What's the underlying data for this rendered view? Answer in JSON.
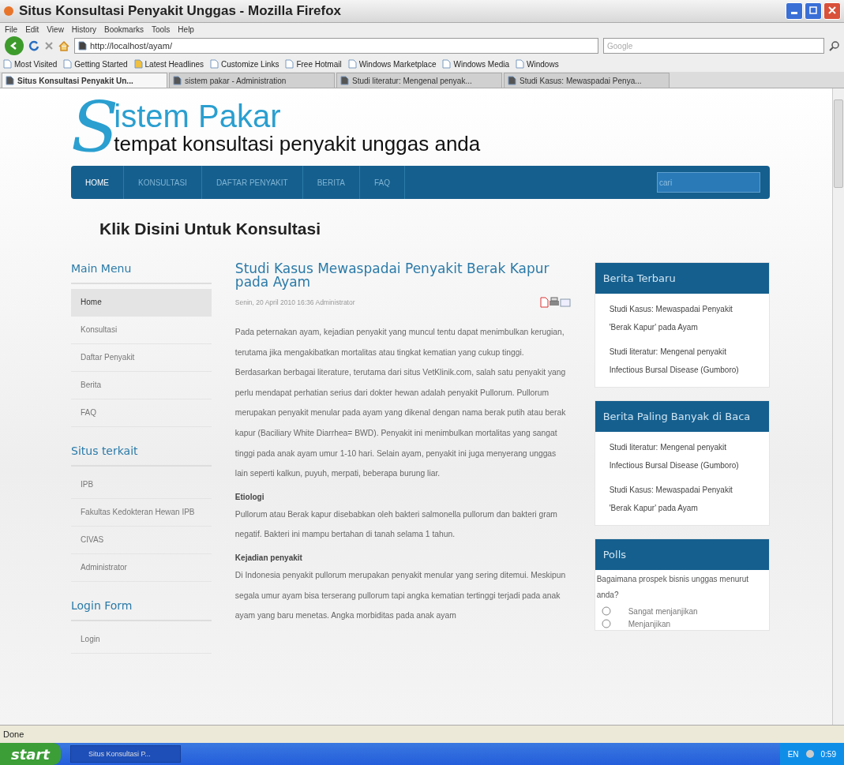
{
  "window": {
    "title": "Situs Konsultasi Penyakit Unggas - Mozilla Firefox"
  },
  "menu": [
    "File",
    "Edit",
    "View",
    "History",
    "Bookmarks",
    "Tools",
    "Help"
  ],
  "address": {
    "value": "http://localhost/ayam/"
  },
  "search": {
    "placeholder": "Google"
  },
  "bookmarks": [
    "Most Visited",
    "Getting Started",
    "Latest Headlines",
    "Customize Links",
    "Free Hotmail",
    "Windows Marketplace",
    "Windows Media",
    "Windows"
  ],
  "tabs": [
    {
      "label": "Situs Konsultasi Penyakit Un...",
      "selected": true
    },
    {
      "label": "sistem pakar - Administration",
      "selected": false
    },
    {
      "label": "Studi literatur: Mengenal penyak...",
      "selected": false
    },
    {
      "label": "Studi Kasus: Mewaspadai Penya...",
      "selected": false
    }
  ],
  "logo": {
    "initial": "S",
    "title": "istem Pakar",
    "tagline": "tempat konsultasi penyakit unggas anda"
  },
  "nav": [
    {
      "label": "HOME",
      "selected": true
    },
    {
      "label": "KONSULTASI",
      "selected": false
    },
    {
      "label": "DAFTAR PENYAKIT",
      "selected": false
    },
    {
      "label": "BERITA",
      "selected": false
    },
    {
      "label": "FAQ",
      "selected": false
    }
  ],
  "nav_search": {
    "placeholder": "cari"
  },
  "banner": "Klik Disini Untuk Konsultasi",
  "sidebar": [
    {
      "title": "Main Menu",
      "items": [
        {
          "label": "Home",
          "selected": true
        },
        {
          "label": "Konsultasi",
          "selected": false
        },
        {
          "label": "Daftar Penyakit",
          "selected": false
        },
        {
          "label": "Berita",
          "selected": false
        },
        {
          "label": "FAQ",
          "selected": false
        }
      ]
    },
    {
      "title": "Situs terkait",
      "items": [
        {
          "label": "IPB",
          "selected": false
        },
        {
          "label": "Fakultas Kedokteran Hewan IPB",
          "selected": false
        },
        {
          "label": "CIVAS",
          "selected": false
        },
        {
          "label": "Administrator",
          "selected": false
        }
      ]
    },
    {
      "title": "Login Form",
      "items": [
        {
          "label": "Login",
          "selected": false
        }
      ]
    }
  ],
  "article": {
    "title": "Studi Kasus Mewaspadai Penyakit Berak Kapur pada Ayam",
    "date": "Senin, 20 April 2010 16:36",
    "author": "Administrator",
    "blocks": [
      {
        "kind": "text",
        "text": "Pada peternakan ayam, kejadian penyakit yang muncul tentu dapat menimbulkan kerugian, terutama jika mengakibatkan mortalitas atau tingkat kematian yang cukup tinggi. Berdasarkan berbagai literature, terutama dari situs VetKlinik.com, salah satu penyakit yang perlu mendapat perhatian serius dari dokter hewan adalah penyakit Pullorum. Pullorum merupakan penyakit menular pada ayam yang dikenal dengan nama berak putih atau berak kapur (Baciliary White Diarrhea= BWD). Penyakit ini menimbulkan mortalitas yang sangat tinggi pada anak ayam umur 1-10 hari. Selain ayam, penyakit ini juga menyerang unggas lain seperti kalkun, puyuh, merpati, beberapa burung liar."
      },
      {
        "kind": "heading",
        "text": "Etiologi"
      },
      {
        "kind": "text",
        "text": "Pullorum atau Berak kapur disebabkan oleh bakteri salmonella pullorum dan bakteri gram negatif. Bakteri ini mampu bertahan di tanah selama 1 tahun."
      },
      {
        "kind": "heading",
        "text": "Kejadian penyakit"
      },
      {
        "kind": "text",
        "text": "Di Indonesia penyakit pullorum merupakan penyakit menular yang sering ditemui. Meskipun segala umur ayam bisa terserang pullorum tapi angka kematian tertinggi terjadi pada anak ayam yang baru menetas. Angka morbiditas pada anak ayam"
      }
    ]
  },
  "modules": [
    {
      "title": "Berita Terbaru",
      "links": [
        "Studi Kasus: Mewaspadai Penyakit 'Berak Kapur' pada Ayam",
        "Studi literatur: Mengenal penyakit Infectious Bursal Disease (Gumboro)"
      ]
    },
    {
      "title": "Berita Paling Banyak di Baca",
      "links": [
        "Studi literatur: Mengenal penyakit Infectious Bursal Disease (Gumboro)",
        "Studi Kasus: Mewaspadai Penyakit 'Berak Kapur' pada Ayam"
      ]
    }
  ],
  "poll": {
    "title": "Polls",
    "question": "Bagaimana prospek bisnis unggas menurut anda?",
    "options": [
      {
        "label": "Sangat menjanjikan",
        "selected": false
      },
      {
        "label": "Menjanjikan",
        "selected": false
      }
    ]
  },
  "status_bar": "Done",
  "taskbar": {
    "start": "start",
    "task": "Situs Konsultasi P...",
    "lang": "EN",
    "time": "0:59"
  }
}
